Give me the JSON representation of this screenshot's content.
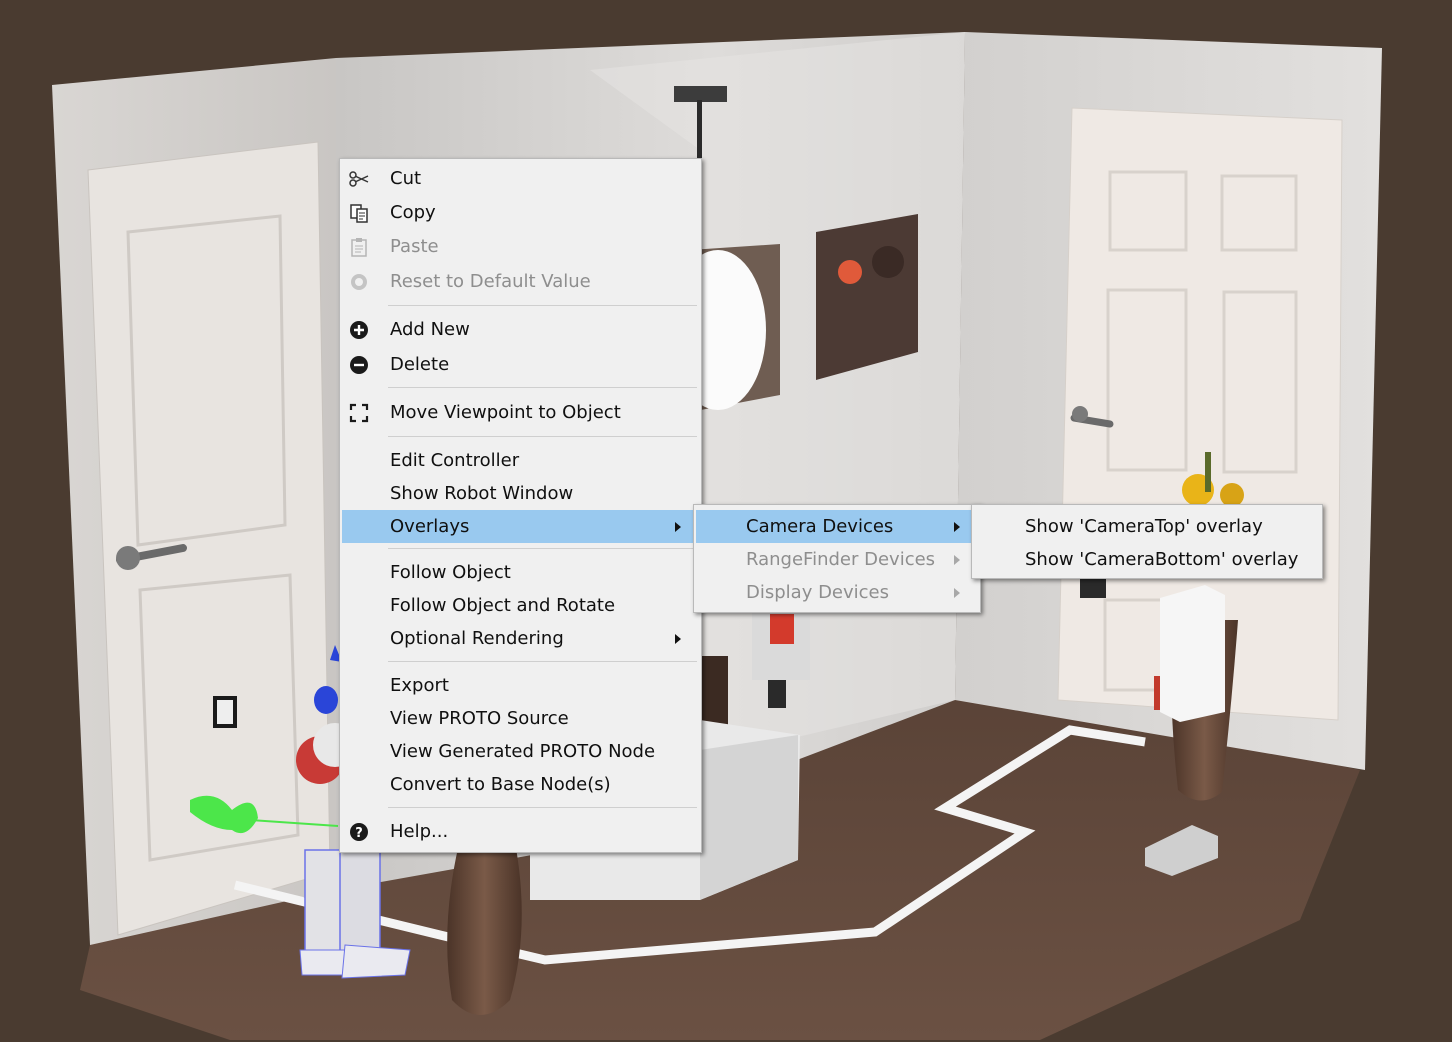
{
  "context_menu": {
    "items": [
      {
        "label": "Cut",
        "icon": "scissors-icon",
        "disabled": false
      },
      {
        "label": "Copy",
        "icon": "copy-icon",
        "disabled": false
      },
      {
        "label": "Paste",
        "icon": "paste-icon",
        "disabled": true
      },
      {
        "label": "Reset to Default Value",
        "icon": "reset-icon",
        "disabled": true
      },
      {
        "label": "Add New",
        "icon": "plus-circle-icon",
        "disabled": false
      },
      {
        "label": "Delete",
        "icon": "minus-circle-icon",
        "disabled": false
      },
      {
        "label": "Move Viewpoint to Object",
        "icon": "focus-frame-icon",
        "disabled": false
      },
      {
        "label": "Edit Controller",
        "disabled": false
      },
      {
        "label": "Show Robot Window",
        "disabled": false
      },
      {
        "label": "Overlays",
        "disabled": false,
        "highlighted": true,
        "submenu": true
      },
      {
        "label": "Follow Object",
        "disabled": false
      },
      {
        "label": "Follow Object and Rotate",
        "disabled": false
      },
      {
        "label": "Optional Rendering",
        "disabled": false,
        "submenu": true
      },
      {
        "label": "Export",
        "disabled": false
      },
      {
        "label": "View PROTO Source",
        "disabled": false
      },
      {
        "label": "View Generated PROTO Node",
        "disabled": false
      },
      {
        "label": "Convert to Base Node(s)",
        "disabled": false
      },
      {
        "label": "Help...",
        "icon": "help-icon",
        "disabled": false
      }
    ]
  },
  "overlays_submenu": {
    "items": [
      {
        "label": "Camera Devices",
        "disabled": false,
        "highlighted": true
      },
      {
        "label": "RangeFinder Devices",
        "disabled": true
      },
      {
        "label": "Display Devices",
        "disabled": true
      }
    ]
  },
  "camera_submenu": {
    "items": [
      {
        "label": "Show 'CameraTop' overlay"
      },
      {
        "label": "Show 'CameraBottom' overlay"
      }
    ]
  },
  "colors": {
    "background": "#4a3b30",
    "menu_background": "#f0f0f0",
    "highlight": "#99c9ef",
    "disabled_text": "#8e8e8e"
  }
}
